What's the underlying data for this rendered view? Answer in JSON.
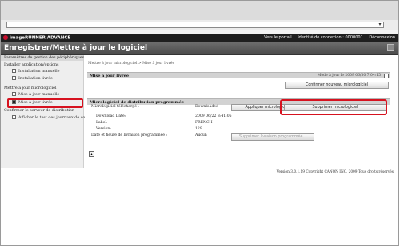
{
  "browser": {
    "address_value": "",
    "dropdown_glyph": "▾"
  },
  "app": {
    "brand": "imageRUNNER ADVANCE",
    "top_links": {
      "portal": "Vers le portail",
      "login_id": "Identité de connexion : 0000001",
      "logout": "Déconnexion"
    },
    "page_title": "Enregistrer/Mettre à jour le logiciel"
  },
  "sidebar": {
    "top": "Paramètres de gestion des périphériques",
    "install_head": "Installer application/options",
    "install_manual": "Installation manuelle",
    "install_history": "Installation livrée",
    "update_head": "Mettre à jour micrologiciel",
    "update_manual": "Mise à jour manuelle",
    "update_delivered": "Mise à jour livrée",
    "confirm_head": "Confirmer le serveur de distribution",
    "show_log": "Afficher le test des journaux de communication"
  },
  "content": {
    "breadcrumb": "Mettre à jour micrologiciel > Mise à jour livrée",
    "section1_title": "Mise à jour livrée",
    "section1_status": "Mode à jour le 2009 06/30 7:04:15",
    "confirm_button": "Confirmer nouveau micrologiciel",
    "section2_title": "Micrologiciel de distribution programmée",
    "fw_downloaded_label": "Micrologiciel téléchargé :",
    "fw_downloaded_value": "Downloaded",
    "apply_button": "Appliquer micrologiciel",
    "delete_button": "Supprimer micrologiciel",
    "download_date_label": "Download Date:",
    "download_date_value": "2009 06/22 8:41:05",
    "label_label": "Label:",
    "label_value": "FRENCH",
    "version_label": "Version:",
    "version_value": "129",
    "schedule_label": "Date et heure de livraison programmée :",
    "schedule_value": "Aucun",
    "cancel_schedule_button": "Supprimer livraison programmée..."
  },
  "footer": {
    "copyright": "Version 3.0.1.19 Copyright CANON INC. 2009 Tous droits réservés"
  }
}
